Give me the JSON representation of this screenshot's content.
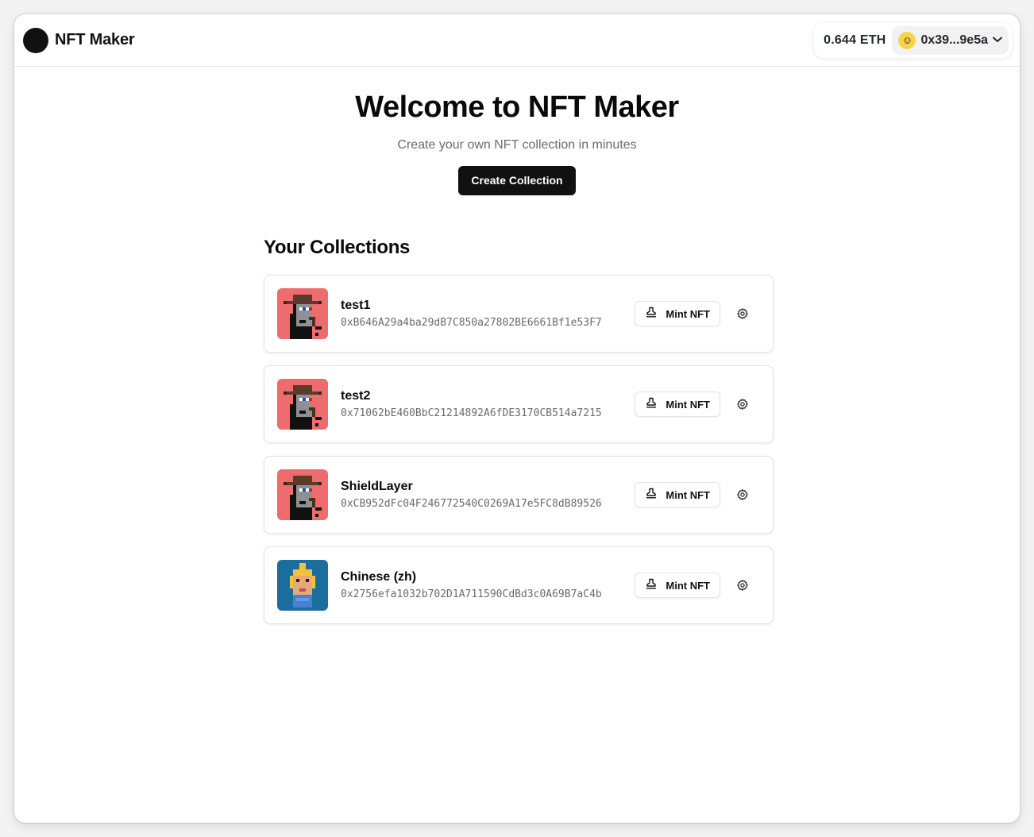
{
  "header": {
    "brand": "NFT Maker",
    "wallet": {
      "balance": "0.644 ETH",
      "address": "0x39...9e5a",
      "avatar_icon": "smiley-emoji-icon"
    }
  },
  "hero": {
    "title": "Welcome to NFT Maker",
    "subtitle": "Create your own NFT collection in minutes",
    "cta_label": "Create Collection"
  },
  "collections": {
    "heading": "Your Collections",
    "items": [
      {
        "name": "test1",
        "address": "0xB646A29a4ba29dB7C850a27802BE6661Bf1e53F7",
        "mint_label": "Mint NFT",
        "thumb": "pirate-punk",
        "thumb_bg": "#ee6b6e"
      },
      {
        "name": "test2",
        "address": "0x71062bE460BbC21214892A6fDE3170CB514a7215",
        "mint_label": "Mint NFT",
        "thumb": "pirate-punk",
        "thumb_bg": "#ee6b6e"
      },
      {
        "name": "ShieldLayer",
        "address": "0xCB952dFc04F246772540C0269A17e5FC8dB89526",
        "mint_label": "Mint NFT",
        "thumb": "pirate-punk",
        "thumb_bg": "#ee6b6e"
      },
      {
        "name": "Chinese (zh)",
        "address": "0x2756efa1032b702D1A711590CdBd3c0A69B7aC4b",
        "mint_label": "Mint NFT",
        "thumb": "blonde-punk",
        "thumb_bg": "#1a6e9e"
      }
    ]
  },
  "colors": {
    "primary_button": "#111111",
    "accent_avatar": "#f6d54a"
  }
}
